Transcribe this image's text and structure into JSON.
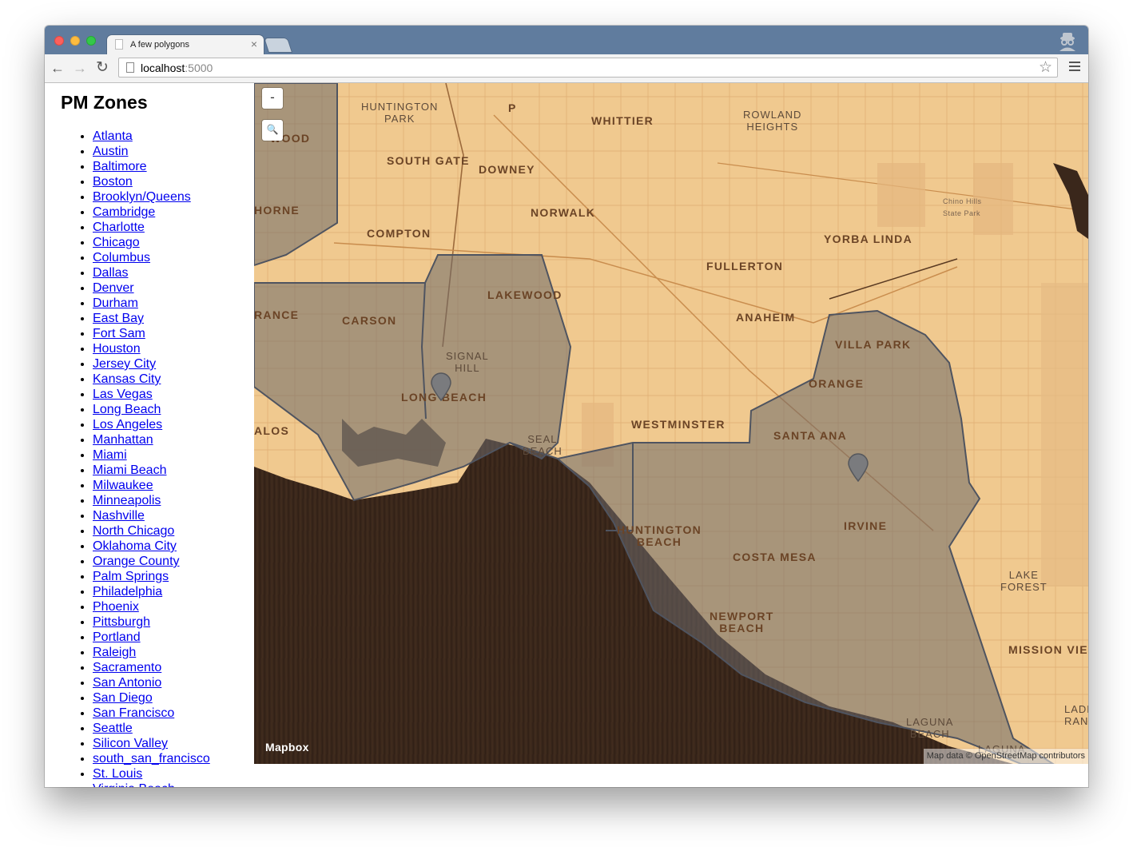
{
  "browser": {
    "tab_title": "A few polygons",
    "tab_close": "×",
    "url_host": "localhost",
    "url_port": ":5000"
  },
  "sidebar": {
    "heading": "PM Zones",
    "links": [
      "Atlanta",
      "Austin",
      "Baltimore",
      "Boston",
      "Brooklyn/Queens",
      "Cambridge",
      "Charlotte",
      "Chicago",
      "Columbus",
      "Dallas",
      "Denver",
      "Durham",
      "East Bay",
      "Fort Sam",
      "Houston",
      "Jersey City",
      "Kansas City",
      "Las Vegas",
      "Long Beach",
      "Los Angeles",
      "Manhattan",
      "Miami",
      "Miami Beach",
      "Milwaukee",
      "Minneapolis",
      "Nashville",
      "North Chicago",
      "Oklahoma City",
      "Orange County",
      "Palm Springs",
      "Philadelphia",
      "Phoenix",
      "Pittsburgh",
      "Portland",
      "Raleigh",
      "Sacramento",
      "San Antonio",
      "San Diego",
      "San Francisco",
      "Seattle",
      "Silicon Valley",
      "south_san_francisco",
      "St. Louis",
      "Virginia Beach"
    ]
  },
  "map": {
    "zoom_out": "-",
    "search_icon": "🔍",
    "wordmark": "Mapbox",
    "attribution": "Map data © OpenStreetMap contributors",
    "labels": {
      "huntington_park": "HUNTINGTON\nPARK",
      "whittier": "WHITTIER",
      "rowland_heights": "ROWLAND\nHEIGHTS",
      "south_gate": "SOUTH GATE",
      "downey": "DOWNEY",
      "norwalk": "NORWALK",
      "compton": "COMPTON",
      "yorba_linda": "YORBA LINDA",
      "fullerton": "FULLERTON",
      "lakewood": "LAKEWOOD",
      "carson": "CARSON",
      "anaheim": "ANAHEIM",
      "villa_park": "VILLA PARK",
      "signal_hill": "SIGNAL\nHILL",
      "orange": "ORANGE",
      "long_beach": "LONG BEACH",
      "westminster": "WESTMINSTER",
      "santa_ana": "SANTA ANA",
      "seal_beach": "SEAL\nBEACH",
      "huntington_beach": "HUNTINGTON\nBEACH",
      "irvine": "IRVINE",
      "costa_mesa": "COSTA MESA",
      "lake_forest": "LAKE\nFOREST",
      "newport_beach": "NEWPORT\nBEACH",
      "mission_viejo": "MISSION VIE",
      "laguna_beach": "LAGUNA\nBEACH",
      "ladera_ranch": "LADE\nRANC",
      "chino_hills": "Chino Hills\nState Park",
      "frag_wood": "WOOD",
      "frag_horne": "HORNE",
      "frag_rance": "RANCE",
      "frag_alos": "ALOS",
      "frag_p": "P",
      "laguna_niguel": "LAGUNA"
    },
    "colors": {
      "land": "#f0c98f",
      "water": "#3a271b",
      "zone_fill": "#6e6a6a",
      "zone_stroke": "#4f5460"
    }
  }
}
